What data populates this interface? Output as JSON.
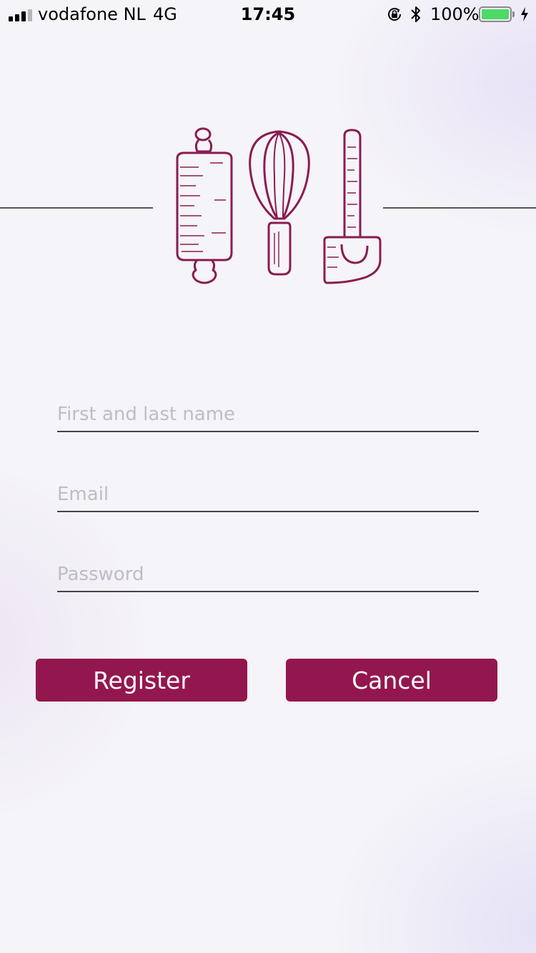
{
  "status_bar": {
    "carrier": "vodafone NL",
    "network": "4G",
    "time": "17:45",
    "battery_percent": "100%",
    "battery_level": 1.0,
    "signal_bars_filled": 3,
    "signal_bars_total": 4,
    "icons": [
      "signal-icon",
      "orientation-lock-icon",
      "bluetooth-icon",
      "battery-icon",
      "charging-icon"
    ]
  },
  "logo": {
    "icons": [
      "rolling-pin-icon",
      "whisk-icon",
      "spatula-icon"
    ]
  },
  "form": {
    "name_placeholder": "First and last name",
    "email_placeholder": "Email",
    "password_placeholder": "Password",
    "name_value": "",
    "email_value": "",
    "password_value": ""
  },
  "actions": {
    "register_label": "Register",
    "cancel_label": "Cancel"
  },
  "colors": {
    "accent": "#93174f",
    "battery": "#4cd964",
    "placeholder": "#bfbcc6"
  }
}
